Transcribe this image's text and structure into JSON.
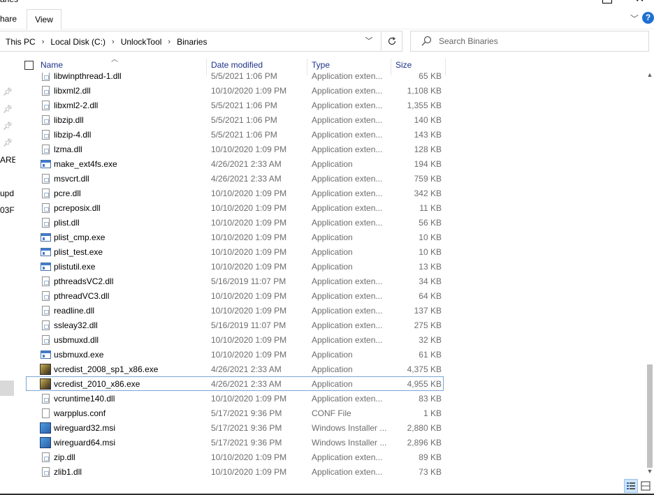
{
  "window": {
    "title_fragment": "aries"
  },
  "ribbon": {
    "tabs": [
      {
        "label": "hare"
      },
      {
        "label": "View"
      }
    ],
    "help_label": "?"
  },
  "address": {
    "crumbs": [
      "This PC",
      "Local Disk (C:)",
      "UnlockTool",
      "Binaries"
    ],
    "separator": "›"
  },
  "search": {
    "placeholder": "Search Binaries"
  },
  "nav_pane": {
    "fragments": [
      "ARE",
      "upd",
      "03F"
    ]
  },
  "columns": {
    "name": "Name",
    "date": "Date modified",
    "type": "Type",
    "size": "Size"
  },
  "files": [
    {
      "name": "libwinpthread-1.dll",
      "date": "5/5/2021 1:06 PM",
      "type": "Application exten...",
      "size": "65 KB",
      "icon": "dll-icon"
    },
    {
      "name": "libxml2.dll",
      "date": "10/10/2020 1:09 PM",
      "type": "Application exten...",
      "size": "1,108 KB",
      "icon": "dll-icon"
    },
    {
      "name": "libxml2-2.dll",
      "date": "5/5/2021 1:06 PM",
      "type": "Application exten...",
      "size": "1,355 KB",
      "icon": "dll-icon"
    },
    {
      "name": "libzip.dll",
      "date": "5/5/2021 1:06 PM",
      "type": "Application exten...",
      "size": "140 KB",
      "icon": "dll-icon"
    },
    {
      "name": "libzip-4.dll",
      "date": "5/5/2021 1:06 PM",
      "type": "Application exten...",
      "size": "143 KB",
      "icon": "dll-icon"
    },
    {
      "name": "lzma.dll",
      "date": "10/10/2020 1:09 PM",
      "type": "Application exten...",
      "size": "128 KB",
      "icon": "dll-icon"
    },
    {
      "name": "make_ext4fs.exe",
      "date": "4/26/2021 2:33 AM",
      "type": "Application",
      "size": "194 KB",
      "icon": "exe-icon"
    },
    {
      "name": "msvcrt.dll",
      "date": "4/26/2021 2:33 AM",
      "type": "Application exten...",
      "size": "759 KB",
      "icon": "dll-icon"
    },
    {
      "name": "pcre.dll",
      "date": "10/10/2020 1:09 PM",
      "type": "Application exten...",
      "size": "342 KB",
      "icon": "dll-icon"
    },
    {
      "name": "pcreposix.dll",
      "date": "10/10/2020 1:09 PM",
      "type": "Application exten...",
      "size": "11 KB",
      "icon": "dll-icon"
    },
    {
      "name": "plist.dll",
      "date": "10/10/2020 1:09 PM",
      "type": "Application exten...",
      "size": "56 KB",
      "icon": "dll-icon"
    },
    {
      "name": "plist_cmp.exe",
      "date": "10/10/2020 1:09 PM",
      "type": "Application",
      "size": "10 KB",
      "icon": "exe-icon"
    },
    {
      "name": "plist_test.exe",
      "date": "10/10/2020 1:09 PM",
      "type": "Application",
      "size": "10 KB",
      "icon": "exe-icon"
    },
    {
      "name": "plistutil.exe",
      "date": "10/10/2020 1:09 PM",
      "type": "Application",
      "size": "13 KB",
      "icon": "exe-icon"
    },
    {
      "name": "pthreadsVC2.dll",
      "date": "5/16/2019 11:07 PM",
      "type": "Application exten...",
      "size": "34 KB",
      "icon": "dll-icon"
    },
    {
      "name": "pthreadVC3.dll",
      "date": "10/10/2020 1:09 PM",
      "type": "Application exten...",
      "size": "64 KB",
      "icon": "dll-icon"
    },
    {
      "name": "readline.dll",
      "date": "10/10/2020 1:09 PM",
      "type": "Application exten...",
      "size": "137 KB",
      "icon": "dll-icon"
    },
    {
      "name": "ssleay32.dll",
      "date": "5/16/2019 11:07 PM",
      "type": "Application exten...",
      "size": "275 KB",
      "icon": "dll-icon"
    },
    {
      "name": "usbmuxd.dll",
      "date": "10/10/2020 1:09 PM",
      "type": "Application exten...",
      "size": "32 KB",
      "icon": "dll-icon"
    },
    {
      "name": "usbmuxd.exe",
      "date": "10/10/2020 1:09 PM",
      "type": "Application",
      "size": "61 KB",
      "icon": "exe-icon"
    },
    {
      "name": "vcredist_2008_sp1_x86.exe",
      "date": "4/26/2021 2:33 AM",
      "type": "Application",
      "size": "4,375 KB",
      "icon": "installer-icon"
    },
    {
      "name": "vcredist_2010_x86.exe",
      "date": "4/26/2021 2:33 AM",
      "type": "Application",
      "size": "4,955 KB",
      "icon": "installer-icon",
      "selected": true
    },
    {
      "name": "vcruntime140.dll",
      "date": "10/10/2020 1:09 PM",
      "type": "Application exten...",
      "size": "83 KB",
      "icon": "dll-icon"
    },
    {
      "name": "warpplus.conf",
      "date": "5/17/2021 9:36 PM",
      "type": "CONF File",
      "size": "1 KB",
      "icon": "file-icon"
    },
    {
      "name": "wireguard32.msi",
      "date": "5/17/2021 9:36 PM",
      "type": "Windows Installer ...",
      "size": "2,880 KB",
      "icon": "msi-icon"
    },
    {
      "name": "wireguard64.msi",
      "date": "5/17/2021 9:36 PM",
      "type": "Windows Installer ...",
      "size": "2,896 KB",
      "icon": "msi-icon"
    },
    {
      "name": "zip.dll",
      "date": "10/10/2020 1:09 PM",
      "type": "Application exten...",
      "size": "89 KB",
      "icon": "dll-icon"
    },
    {
      "name": "zlib1.dll",
      "date": "10/10/2020 1:09 PM",
      "type": "Application exten...",
      "size": "73 KB",
      "icon": "dll-icon"
    }
  ],
  "colors": {
    "header_text": "#1e3287",
    "secondary_text": "#6d6d6d",
    "selection_border": "#7aa6d6",
    "help_blue": "#1f6fd1"
  }
}
